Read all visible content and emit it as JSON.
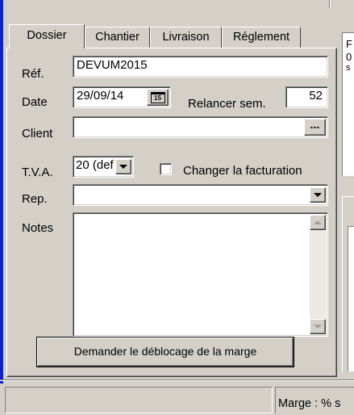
{
  "tabs": [
    "Dossier",
    "Chantier",
    "Livraison",
    "Réglement"
  ],
  "form": {
    "ref_label": "Réf.",
    "ref_value": "DEVUM2015",
    "date_label": "Date",
    "date_value": "29/09/14",
    "calendar_text": "15",
    "relancer_label": "Relancer sem.",
    "relancer_value": "52",
    "client_label": "Client",
    "client_value": "",
    "client_browse": "...",
    "tva_label": "T.V.A.",
    "tva_value": "20 (def",
    "changer_label": "Changer la facturation",
    "rep_label": "Rep.",
    "rep_value": "",
    "notes_label": "Notes",
    "notes_value": "",
    "marge_button": "Demander le déblocage de la marge"
  },
  "right_panel": {
    "line1": "F",
    "line2": "0",
    "line3": "s"
  },
  "status_bar": {
    "marge_text": "Marge : % s"
  },
  "colors": {
    "face": "#d4d0c8",
    "accent_left": "#0a24c8"
  }
}
